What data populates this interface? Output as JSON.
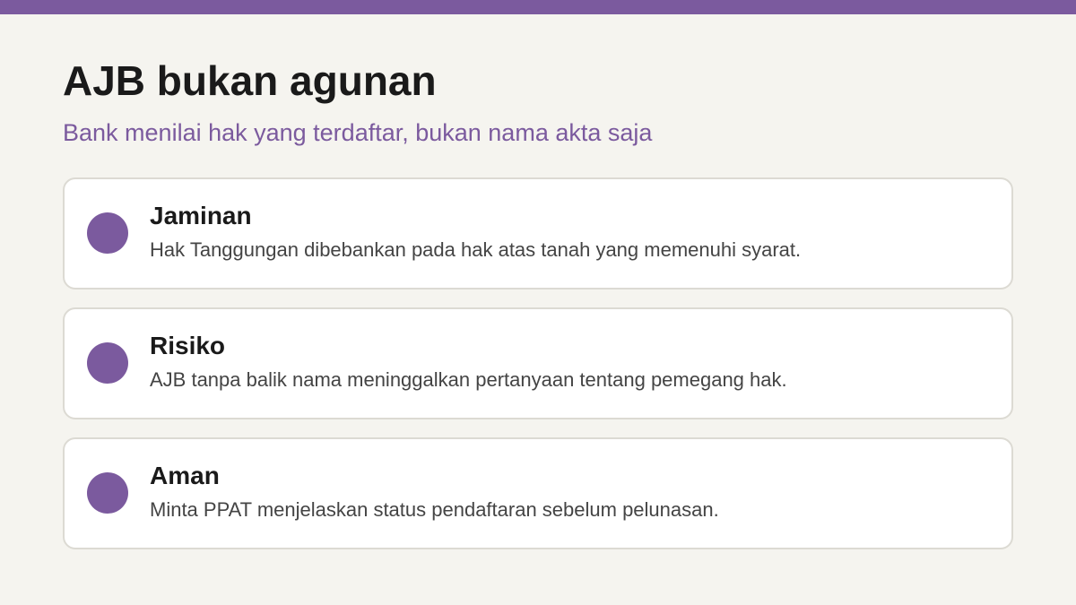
{
  "colors": {
    "accent": "#7b5a9e",
    "background": "#f5f4ef",
    "card_background": "#ffffff",
    "card_border": "#dcdad3",
    "title": "#1a1a1a",
    "body_text": "#444444"
  },
  "slide": {
    "title": "AJB bukan agunan",
    "subtitle": "Bank menilai hak yang terdaftar, bukan nama akta saja"
  },
  "cards": [
    {
      "title": "Jaminan",
      "text": "Hak Tanggungan dibebankan pada hak atas tanah yang memenuhi syarat."
    },
    {
      "title": "Risiko",
      "text": "AJB tanpa balik nama meninggalkan pertanyaan tentang pemegang hak."
    },
    {
      "title": "Aman",
      "text": "Minta PPAT menjelaskan status pendaftaran sebelum pelunasan."
    }
  ]
}
